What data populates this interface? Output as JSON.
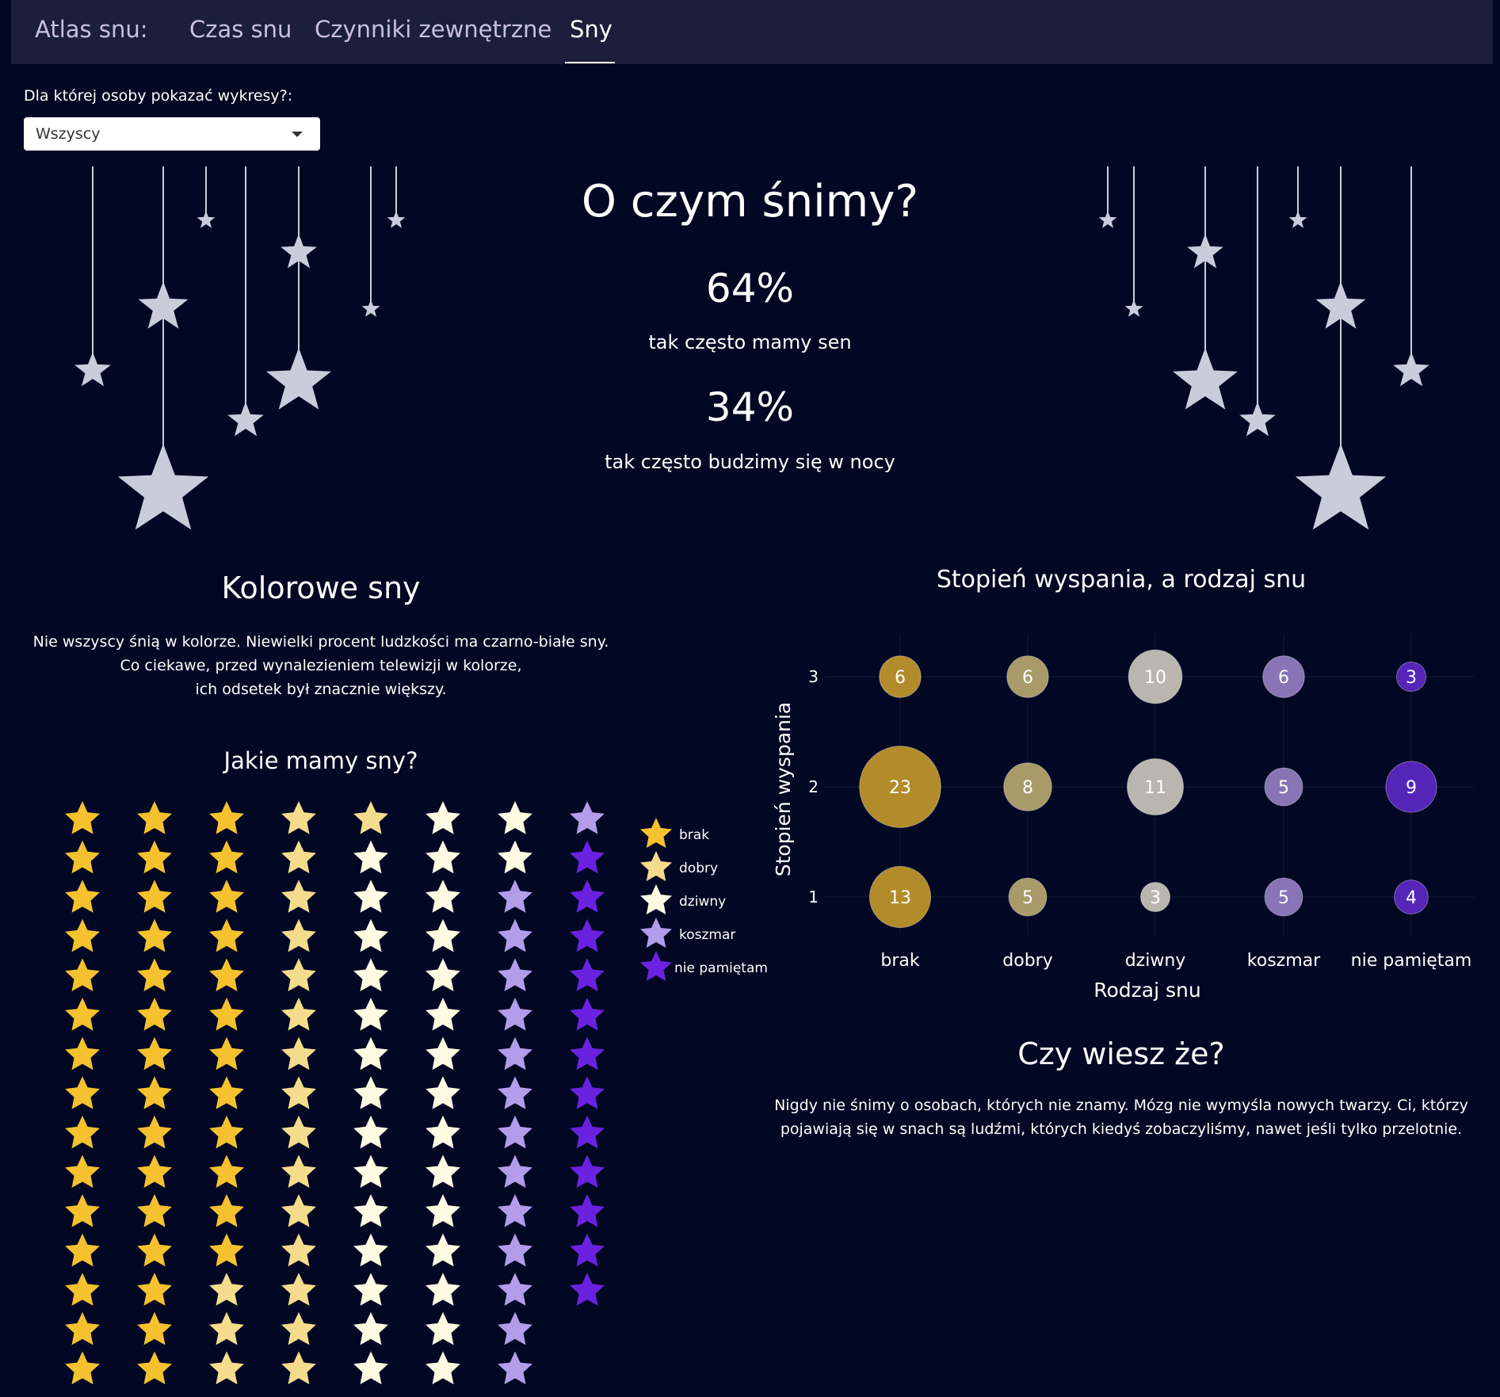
{
  "navbar": {
    "brand": "Atlas snu:",
    "tabs": [
      {
        "label": "Czas snu",
        "active": false
      },
      {
        "label": "Czynniki zewnętrzne",
        "active": false
      },
      {
        "label": "Sny",
        "active": true
      }
    ]
  },
  "person_select": {
    "label": "Dla której osoby pokazać wykresy?:",
    "value": "Wszyscy"
  },
  "hero": {
    "title": "O czym śnimy?",
    "stat1_value": "64%",
    "stat1_text": "tak często mamy sen",
    "stat2_value": "34%",
    "stat2_text": "tak często budzimy się w nocy"
  },
  "colorful_dreams": {
    "title": "Kolorowe sny",
    "lines": [
      "Nie wszyscy śnią w kolorze. Niewielki procent ludzkości ma czarno-białe sny.",
      "Co ciekawe, przed wynalezieniem telewizji w kolorze,",
      "ich odsetek był znacznie większy."
    ]
  },
  "did_you_know": {
    "title": "Czy wiesz że?",
    "lines": [
      "Nigdy nie śnimy o osobach, których nie znamy. Mózg nie wymyśla nowych twarzy. Ci, którzy",
      "pojawiają się w snach są ludźmi, których kiedyś zobaczyliśmy, nawet jeśli tylko przelotnie."
    ]
  },
  "colors": {
    "background": "#020723",
    "navbar": "#1b1f3b",
    "hanging_star": "#c9ccdb",
    "brak": "#f5c12e",
    "dobry": "#f4dc8c",
    "dziwny": "#fffbe3",
    "koszmar": "#b39dea",
    "nie_pamietam": "#6a22e0",
    "bubble_brak": "#b28c2b",
    "bubble_dobry": "#a89a69",
    "bubble_dziwny": "#b9b6b0",
    "bubble_koszmar": "#8974b6",
    "bubble_nie_pamietam": "#5525b8"
  },
  "chart_data": [
    {
      "type": "waffle",
      "title": "Jakie mamy sny?",
      "unit": "star",
      "columns": 8,
      "order": "column-major from top-left",
      "categories": [
        "brak",
        "dobry",
        "dziwny",
        "koszmar",
        "nie pamiętam"
      ],
      "values": [
        42,
        19,
        31,
        14,
        12
      ],
      "legend": [
        "brak",
        "dobry",
        "dziwny",
        "koszmar",
        "nie pamiętam"
      ],
      "legend_position": "right"
    },
    {
      "type": "scatter",
      "subtype": "bubble",
      "title": "Stopień wyspania, a rodzaj snu",
      "xlabel": "Rodzaj snu",
      "ylabel": "Stopień wyspania",
      "x_categories": [
        "brak",
        "dobry",
        "dziwny",
        "koszmar",
        "nie pamiętam"
      ],
      "y_ticks": [
        1,
        2,
        3
      ],
      "grid": true,
      "points": [
        {
          "x": "brak",
          "y": 3,
          "value": 6
        },
        {
          "x": "dobry",
          "y": 3,
          "value": 6
        },
        {
          "x": "dziwny",
          "y": 3,
          "value": 10
        },
        {
          "x": "koszmar",
          "y": 3,
          "value": 6
        },
        {
          "x": "nie pamiętam",
          "y": 3,
          "value": 3
        },
        {
          "x": "brak",
          "y": 2,
          "value": 23
        },
        {
          "x": "dobry",
          "y": 2,
          "value": 8
        },
        {
          "x": "dziwny",
          "y": 2,
          "value": 11
        },
        {
          "x": "koszmar",
          "y": 2,
          "value": 5
        },
        {
          "x": "nie pamiętam",
          "y": 2,
          "value": 9
        },
        {
          "x": "brak",
          "y": 1,
          "value": 13
        },
        {
          "x": "dobry",
          "y": 1,
          "value": 5
        },
        {
          "x": "dziwny",
          "y": 1,
          "value": 3
        },
        {
          "x": "koszmar",
          "y": 1,
          "value": 5
        },
        {
          "x": "nie pamiętam",
          "y": 1,
          "value": 4
        }
      ]
    }
  ]
}
